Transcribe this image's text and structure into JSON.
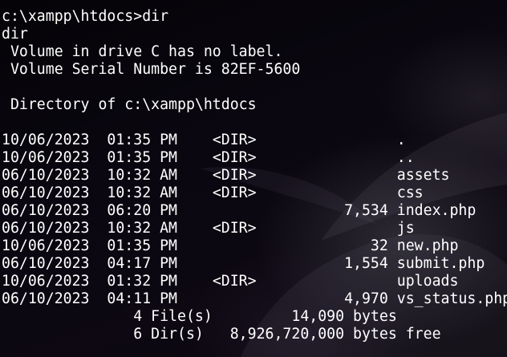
{
  "terminal": {
    "prompt": "c:\\xampp\\htdocs>",
    "command": "dir",
    "echo": "dir",
    "volume_label_line": " Volume in drive C has no label.",
    "volume_serial_line": " Volume Serial Number is 82EF-5600",
    "directory_line": " Directory of c:\\xampp\\htdocs",
    "entries": [
      {
        "date": "10/06/2023",
        "time": "01:35 PM",
        "type": "<DIR>",
        "size": "",
        "name": "."
      },
      {
        "date": "10/06/2023",
        "time": "01:35 PM",
        "type": "<DIR>",
        "size": "",
        "name": ".."
      },
      {
        "date": "06/10/2023",
        "time": "10:32 AM",
        "type": "<DIR>",
        "size": "",
        "name": "assets"
      },
      {
        "date": "06/10/2023",
        "time": "10:32 AM",
        "type": "<DIR>",
        "size": "",
        "name": "css"
      },
      {
        "date": "06/10/2023",
        "time": "06:20 PM",
        "type": "",
        "size": "7,534",
        "name": "index.php"
      },
      {
        "date": "06/10/2023",
        "time": "10:32 AM",
        "type": "<DIR>",
        "size": "",
        "name": "js"
      },
      {
        "date": "10/06/2023",
        "time": "01:35 PM",
        "type": "",
        "size": "32",
        "name": "new.php"
      },
      {
        "date": "06/10/2023",
        "time": "04:17 PM",
        "type": "",
        "size": "1,554",
        "name": "submit.php"
      },
      {
        "date": "10/06/2023",
        "time": "01:32 PM",
        "type": "<DIR>",
        "size": "",
        "name": "uploads"
      },
      {
        "date": "06/10/2023",
        "time": "04:11 PM",
        "type": "",
        "size": "4,970",
        "name": "vs_status.php"
      }
    ],
    "summary": {
      "files_count": "4",
      "files_label": "File(s)",
      "files_bytes": "14,090",
      "files_unit": "bytes",
      "dirs_count": "6",
      "dirs_label": "Dir(s)",
      "dirs_bytes": "8,926,720,000",
      "dirs_unit": "bytes free"
    }
  }
}
